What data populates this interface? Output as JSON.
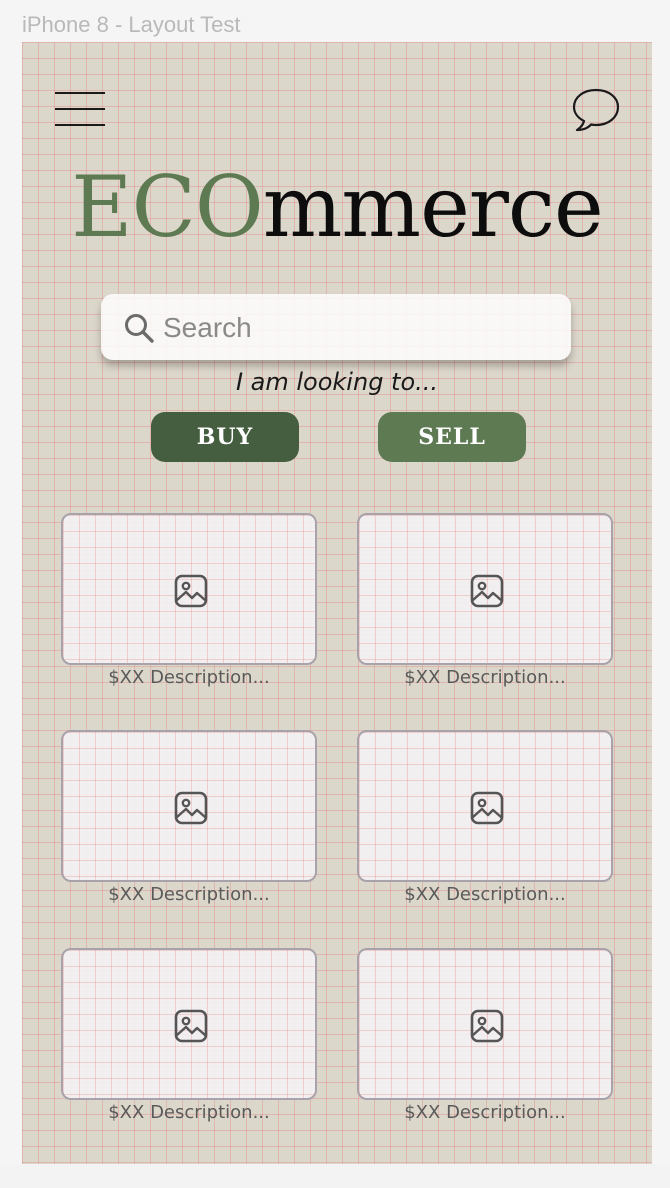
{
  "frame": {
    "label": "iPhone 8 - Layout Test"
  },
  "header": {
    "menu_icon": "hamburger-menu-icon",
    "chat_icon": "speech-bubble-icon"
  },
  "logo": {
    "accent": "ECO",
    "rest": "mmerce",
    "accent_color": "#5e7a52",
    "rest_color": "#0d0d0d"
  },
  "search": {
    "placeholder": "Search",
    "value": ""
  },
  "intent": {
    "prompt": "I am looking to...",
    "buy_label": "BUY",
    "sell_label": "SELL",
    "buy_color": "#445e3f",
    "sell_color": "#5e7a52"
  },
  "products": [
    {
      "caption": "$XX Description..."
    },
    {
      "caption": "$XX Description..."
    },
    {
      "caption": "$XX Description..."
    },
    {
      "caption": "$XX Description..."
    },
    {
      "caption": "$XX Description..."
    },
    {
      "caption": "$XX Description..."
    }
  ],
  "colors": {
    "background": "#dcd7cb",
    "grid": "#e28c8c"
  }
}
